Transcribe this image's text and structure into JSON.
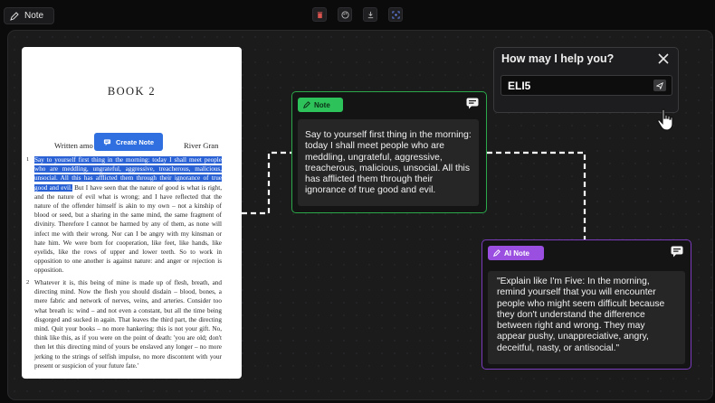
{
  "topbar": {
    "note_tab_label": "Note",
    "tools": [
      "delete-icon",
      "palette-icon",
      "download-icon",
      "focus-icon"
    ]
  },
  "book": {
    "title": "BOOK 2",
    "byline_left": "Written amo",
    "byline_right": "River Gran",
    "create_note_label": "Create Note",
    "para1_num": "1",
    "para1_highlight": "Say to yourself first thing in the morning: today I shall meet people who are meddling, ungrateful, aggressive, treacherous, malicious, unsocial. All this has afflicted them through their ignorance of true good and evil.",
    "para1_rest": " But I have seen that the nature of good is what is right, and the nature of evil what is wrong; and I have reflected that the nature of the offender himself is akin to my own – not a kinship of blood or seed, but a sharing in the same mind, the same fragment of divinity. Therefore I cannot be harmed by any of them, as none will infect me with their wrong. Nor can I be angry with my kinsman or hate him. We were born for cooperation, like feet, like hands, like eyelids, like the rows of upper and lower teeth. So to work in opposition to one another is against nature: and anger or rejection is opposition.",
    "para2_num": "2",
    "para2": "Whatever it is, this being of mine is made up of flesh, breath, and directing mind. Now the flesh you should disdain – blood, bones, a mere fabric and network of nerves, veins, and arteries. Consider too what breath is: wind – and not even a constant, but all the time being disgorged and sucked in again. That leaves the third part, the directing mind. Quit your books – no more hankering: this is not your gift. No, think like this, as if you were on the point of death: 'you are old; don't then let this directing mind of yours be enslaved any longer – no more jerking to the strings of selfish impulse, no more discontent with your present or suspicion of your future fate.'"
  },
  "note_card": {
    "label": "Note",
    "text": "Say to yourself first thing in the morning: today I shall meet people who are meddling, ungrateful, aggressive, treacherous, malicious, unsocial. All this has afflicted them through their ignorance of true good and evil."
  },
  "ai_card": {
    "label": "AI Note",
    "text": "\"Explain like I'm Five: In the morning, remind yourself that you will encounter people who might seem difficult because they don't understand the difference between right and wrong. They may appear pushy, unappreciative, angry, deceitful, nasty, or antisocial.\""
  },
  "help": {
    "title": "How may I help you?",
    "input_value": "ELI5"
  },
  "colors": {
    "note_accent": "#2ec25a",
    "ai_accent": "#9b4fe0",
    "highlight": "#2a62d6"
  }
}
